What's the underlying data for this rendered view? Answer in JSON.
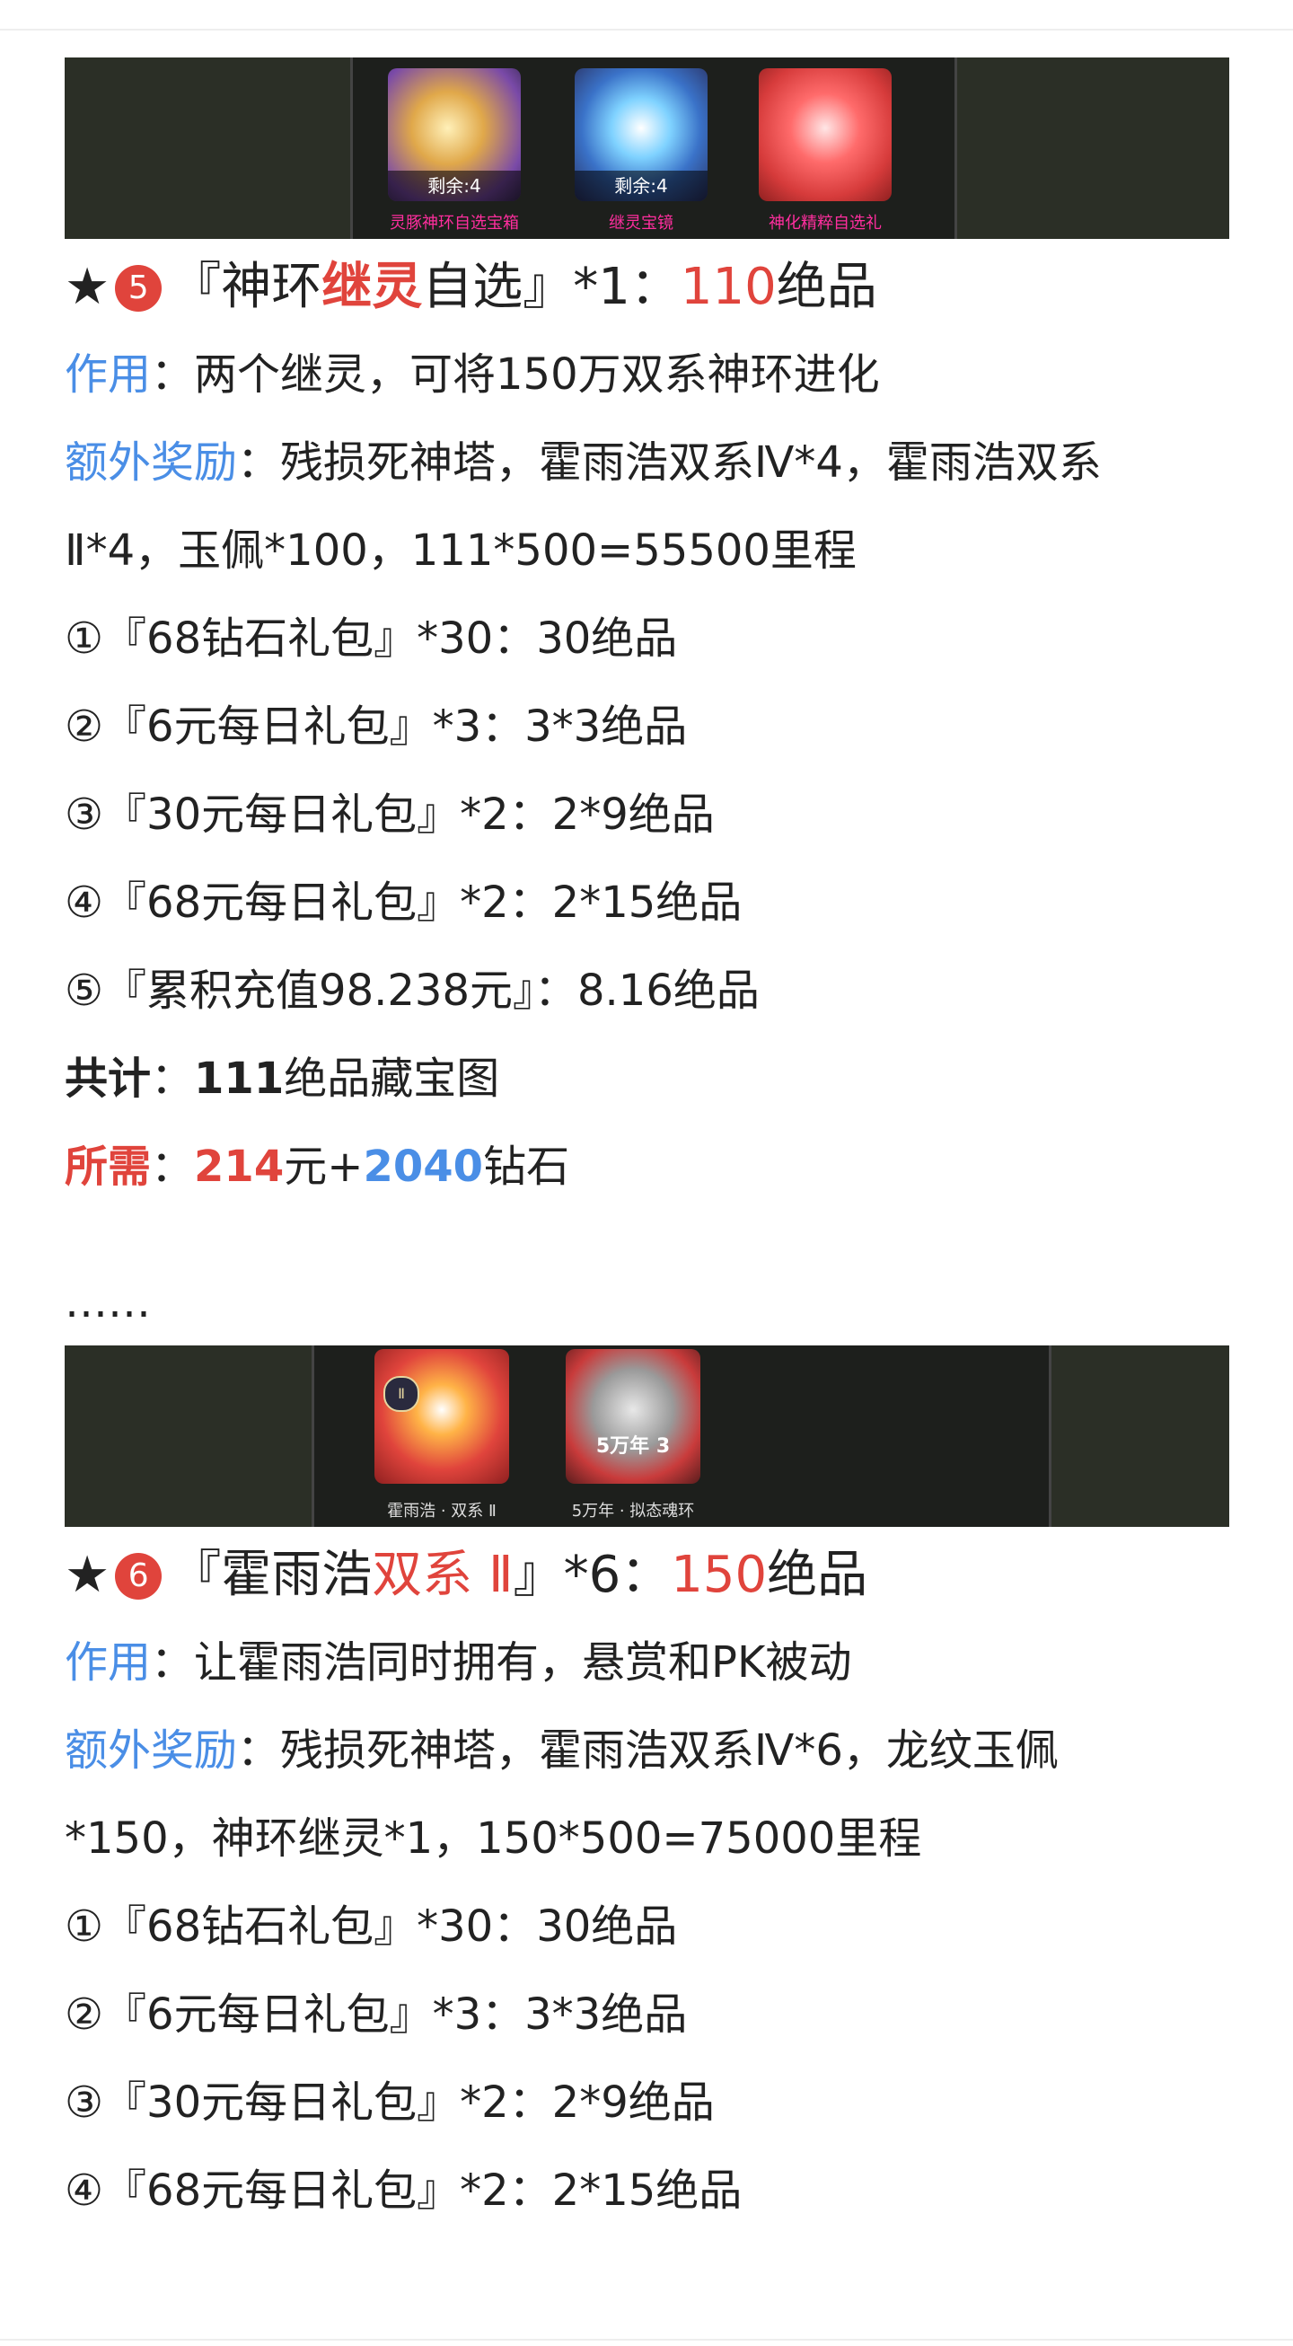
{
  "colors": {
    "accent_red": "#e0443c",
    "accent_blue": "#4a8ee6",
    "caption_pink": "#ff2e9e"
  },
  "banner1": {
    "items": [
      {
        "remain": "剩余:4",
        "caption": "灵豚神环自选宝箱"
      },
      {
        "remain": "剩余:4",
        "caption": "继灵宝镜"
      },
      {
        "caption": "神化精粹自选礼"
      }
    ]
  },
  "section5": {
    "star": "★",
    "num": "5",
    "title_prefix": "『神环",
    "title_highlight": "继灵",
    "title_suffix": "自选』*1：",
    "title_value": "110",
    "title_unit": "绝品",
    "effect_label": "作用",
    "effect_text": "：两个继灵，可将150万双系神环进化",
    "bonus_label": "额外奖励",
    "bonus_text1": "：残损死神塔，霍雨浩双系Ⅳ*4，霍雨浩双系",
    "bonus_text2": "Ⅱ*4，玉佩*100，111*500=55500里程",
    "items": [
      "①『68钻石礼包』*30：30绝品",
      "②『6元每日礼包』*3：3*3绝品",
      "③『30元每日礼包』*2：2*9绝品",
      "④『68元每日礼包』*2：2*15绝品",
      "⑤『累积充值98.238元』：8.16绝品"
    ],
    "total_label": "共计",
    "total_colon": "：",
    "total_value": "111",
    "total_suffix": "绝品藏宝图",
    "need_label": "所需",
    "need_colon": "：",
    "need_yuan": "214",
    "need_mid": "元+",
    "need_diamond": "2040",
    "need_suffix": "钻石"
  },
  "ellipsis": "……",
  "banner2": {
    "items": [
      {
        "caption": "霍雨浩 · 双系 Ⅱ",
        "badge": "Ⅱ"
      },
      {
        "year": "5万年 3",
        "caption": "5万年 · 拟态魂环"
      }
    ]
  },
  "section6": {
    "star": "★",
    "num": "6",
    "title_prefix": "『霍雨浩",
    "title_highlight": "双系 Ⅱ",
    "title_suffix": "』*6：",
    "title_value": "150",
    "title_unit": "绝品",
    "effect_label": "作用",
    "effect_text": "：让霍雨浩同时拥有，悬赏和PK被动",
    "bonus_label": "额外奖励",
    "bonus_text1": "：残损死神塔，霍雨浩双系Ⅳ*6，龙纹玉佩",
    "bonus_text2": "*150，神环继灵*1，150*500=75000里程",
    "items": [
      "①『68钻石礼包』*30：30绝品",
      "②『6元每日礼包』*3：3*3绝品",
      "③『30元每日礼包』*2：2*9绝品",
      "④『68元每日礼包』*2：2*15绝品"
    ]
  }
}
